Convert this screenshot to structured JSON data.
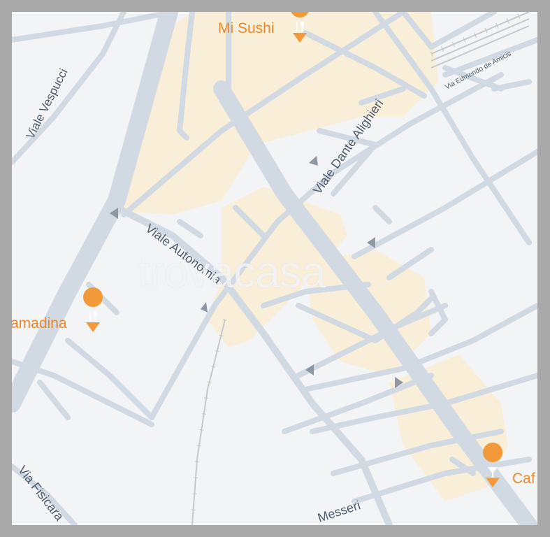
{
  "map": {
    "watermark": "trovacasa",
    "streets": {
      "vespucci": "Viale Vespucci",
      "dante": "Viale Dante Alighieri",
      "amicis": "Via Edmondo de Amicis",
      "autonomia": "Viale Autonomia",
      "fisicara": "Via Fisicara",
      "messeri": "Messeri"
    },
    "pois": [
      {
        "name": "Mi Sushi",
        "icon": "restaurant-icon"
      },
      {
        "name": "amadina",
        "icon": "restaurant-icon"
      },
      {
        "name": "Caf",
        "icon": "bar-icon"
      }
    ],
    "colors": {
      "background": "#f3f4f6",
      "roads": "#d1dae3",
      "commercial_area": "#f9efd8",
      "poi": "#f29a3a",
      "label": "#4d5b6b"
    }
  }
}
